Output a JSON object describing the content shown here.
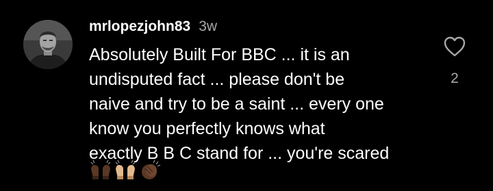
{
  "comment": {
    "username": "mrlopezjohn83",
    "age": "3w",
    "text_lines": [
      "Absolutely Built For BBC ... it is an",
      "undisputed fact ... please don't be",
      "naive and try to be a saint ... every one",
      "know you perfectly knows what",
      "exactly B B C stand for ... you're scared"
    ],
    "reactions": [
      "raising-hands-dark",
      "raising-hands-medium-light",
      "clapping-hands-dark"
    ],
    "like_count": "2"
  },
  "icons": {
    "like": "heart-outline-icon",
    "avatar": "user-avatar-photo"
  },
  "colors": {
    "background": "#000000",
    "text": "#ffffff",
    "secondary_text": "#a8a8a8"
  }
}
